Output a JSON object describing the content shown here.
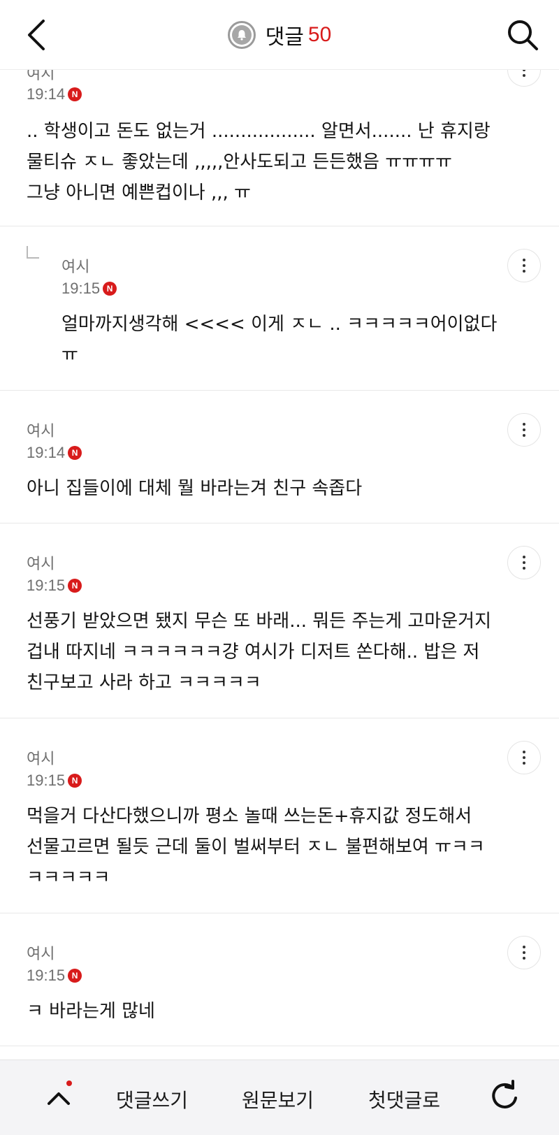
{
  "header": {
    "title": "댓글",
    "count": "50",
    "back_icon": "back-arrow-icon",
    "search_icon": "search-icon",
    "bell_icon": "bell-icon"
  },
  "comments": [
    {
      "author": "여시",
      "time": "19:14",
      "badge": "N",
      "text": ".. 학생이고 돈도 없는거 .................. 알면서....... 난 휴지랑\n물티슈 ㅈㄴ 좋았는데 ,,,,,안사도되고 든든했음 ㅠㅠㅠㅠ\n그냥 아니면 예쁜컵이나 ,,, ㅠ"
    },
    {
      "author": "여시",
      "time": "19:15",
      "badge": "N",
      "text": "얼마까지생각해 <<<< 이게 ㅈㄴ .. ㅋㅋㅋㅋㅋ어이없다\nㅠ",
      "is_reply": true
    },
    {
      "author": "여시",
      "time": "19:14",
      "badge": "N",
      "text": "아니 집들이에 대체 뭘 바라는겨 친구 속좁다"
    },
    {
      "author": "여시",
      "time": "19:15",
      "badge": "N",
      "text": "선풍기 받았으면 됐지 무슨 또 바래... 뭐든 주는게 고마운거지\n겁내 따지네 ㅋㅋㅋㅋㅋㅋ걍 여시가 디저트 쏜다해.. 밥은 저\n친구보고 사라 하고 ㅋㅋㅋㅋㅋ"
    },
    {
      "author": "여시",
      "time": "19:15",
      "badge": "N",
      "text": "먹을거 다산다했으니까 평소 놀때 쓰는돈+휴지값 정도해서\n선물고르면 될듯 근데 둘이 벌써부터 ㅈㄴ 불편해보여 ㅠㅋㅋ\nㅋㅋㅋㅋㅋ"
    },
    {
      "author": "여시",
      "time": "19:15",
      "badge": "N",
      "text": "ㅋ 바라는게 많네"
    }
  ],
  "bottom_bar": {
    "up_icon": "chevron-up-icon",
    "write_label": "댓글쓰기",
    "original_label": "원문보기",
    "first_label": "첫댓글로",
    "refresh_icon": "refresh-icon"
  }
}
